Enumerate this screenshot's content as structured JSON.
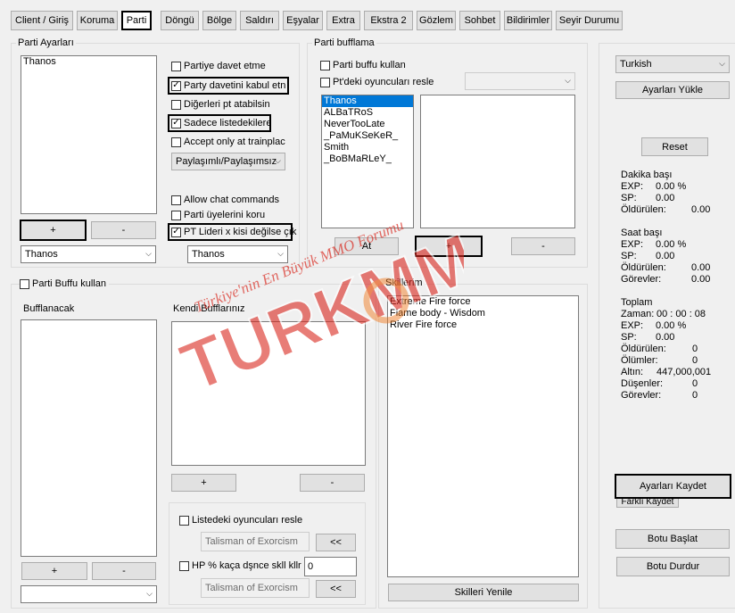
{
  "tabs": [
    "Client / Giriş",
    "Koruma",
    "Parti",
    "Döngü",
    "Bölge",
    "Saldırı",
    "Eşyalar",
    "Extra",
    "Ekstra 2",
    "Gözlem",
    "Sohbet",
    "Bildirimler",
    "Seyir Durumu"
  ],
  "party_settings": {
    "label": "Parti Ayarları",
    "members": [
      "Thanos"
    ],
    "add_label": "+",
    "remove_label": "-",
    "member_select": "Thanos",
    "options": [
      "Partiye davet etme",
      "Party davetini kabul etn",
      "Diğerleri pt atabilsin",
      "Sadece listedekilere",
      "Accept only at trainplac"
    ],
    "share_mode": "Paylaşımlı/Paylaşımsız",
    "options2": [
      "Allow chat commands",
      "Parti üyelerini koru",
      "PT Lideri x kisi değilse çık"
    ],
    "leader_select": "Thanos"
  },
  "party_buff": {
    "label": "Parti bufflama",
    "use_party_buff": "Parti buffu kullan",
    "resle_players": "Pt'deki oyuncuları resle",
    "players": [
      "Thanos",
      "ALBaTRoS",
      "NeverTooLate",
      "_PaMuKSeKeR_",
      "Smith",
      "_BoBMaRLeY_"
    ],
    "at_label": "At",
    "add_label": "+",
    "remove_label": "-"
  },
  "buffs": {
    "use_label": "Parti Buffu kullan",
    "bufflanacak_label": "Bufflanacak",
    "kendi_label": "Kendi Bufflarınız",
    "add_label": "+",
    "remove_label": "-",
    "add2_label": "+",
    "remove2_label": "-",
    "listed_players": "Listedeki oyuncuları resle",
    "skill1": "Talisman of Exorcism",
    "arrow_label": "<<",
    "hp_label": "HP % kaça dşnce skll kllr",
    "hp_value": "0",
    "skill2": "Talisman of Exorcism",
    "arrow2_label": "<<"
  },
  "skills": {
    "label": "Skillerim",
    "items": [
      "Extreme Fire force",
      "Flame body - Wisdom",
      "River Fire force"
    ],
    "refresh": "Skilleri Yenile"
  },
  "right": {
    "language": "Turkish",
    "load_settings": "Ayarları Yükle",
    "reset": "Reset",
    "per_minute": "Dakika başı",
    "exp_label": "EXP:",
    "exp_value": "0.00 %",
    "sp_label": "SP:",
    "sp_value": "0.00",
    "killed_label": "Öldürülen:",
    "killed_value": "0.00",
    "per_hour": "Saat başı",
    "h_exp_label": "EXP:",
    "h_exp_value": "0.00 %",
    "h_sp_label": "SP:",
    "h_sp_value": "0.00",
    "h_killed_label": "Öldürülen:",
    "h_killed_value": "0.00",
    "h_tasks_label": "Görevler:",
    "h_tasks_value": "0.00",
    "total": "Toplam",
    "time_label": "Zaman:",
    "time_value": "00 : 00 : 08",
    "t_exp_label": "EXP:",
    "t_exp_value": "0.00 %",
    "t_sp_label": "SP:",
    "t_sp_value": "0.00",
    "t_killed_label": "Öldürülen:",
    "t_killed_value": "0",
    "deaths_label": "Ölümler:",
    "deaths_value": "0",
    "gold_label": "Altın:",
    "gold_value": "447,000,001",
    "drops_label": "Düşenler:",
    "drops_value": "0",
    "t_tasks_label": "Görevler:",
    "t_tasks_value": "0",
    "save_settings": "Ayarları Kaydet",
    "save_other": "Farklı Kaydet",
    "start_bot": "Botu Başlat",
    "stop_bot": "Botu Durdur"
  },
  "watermark": {
    "slogan": "Türkiye'nin En Büyük MMO Forumu",
    "brand": "TURKMMO"
  },
  "colors": {
    "selection": "#0078d7",
    "watermark_red": "#d9261c",
    "watermark_orange": "#f07a20"
  }
}
